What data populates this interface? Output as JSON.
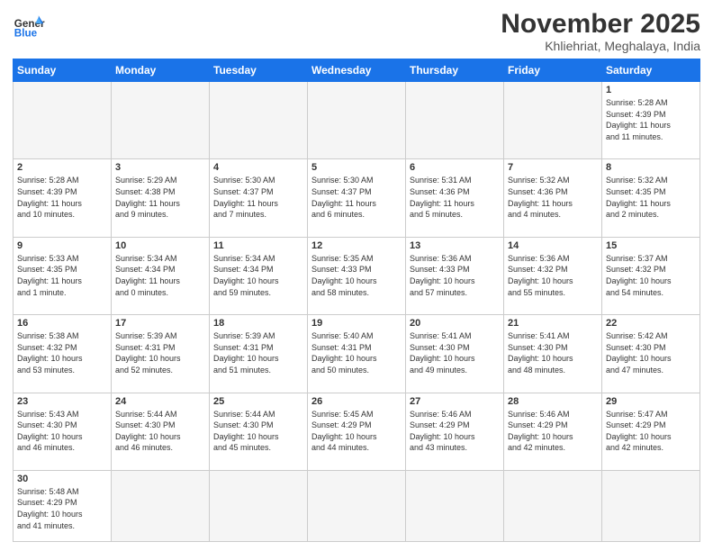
{
  "header": {
    "logo_text_regular": "General",
    "logo_text_blue": "Blue",
    "month_title": "November 2025",
    "subtitle": "Khliehriat, Meghalaya, India"
  },
  "weekdays": [
    "Sunday",
    "Monday",
    "Tuesday",
    "Wednesday",
    "Thursday",
    "Friday",
    "Saturday"
  ],
  "weeks": [
    [
      {
        "day": "",
        "info": ""
      },
      {
        "day": "",
        "info": ""
      },
      {
        "day": "",
        "info": ""
      },
      {
        "day": "",
        "info": ""
      },
      {
        "day": "",
        "info": ""
      },
      {
        "day": "",
        "info": ""
      },
      {
        "day": "1",
        "info": "Sunrise: 5:28 AM\nSunset: 4:39 PM\nDaylight: 11 hours\nand 11 minutes."
      }
    ],
    [
      {
        "day": "2",
        "info": "Sunrise: 5:28 AM\nSunset: 4:39 PM\nDaylight: 11 hours\nand 10 minutes."
      },
      {
        "day": "3",
        "info": "Sunrise: 5:29 AM\nSunset: 4:38 PM\nDaylight: 11 hours\nand 9 minutes."
      },
      {
        "day": "4",
        "info": "Sunrise: 5:30 AM\nSunset: 4:37 PM\nDaylight: 11 hours\nand 7 minutes."
      },
      {
        "day": "5",
        "info": "Sunrise: 5:30 AM\nSunset: 4:37 PM\nDaylight: 11 hours\nand 6 minutes."
      },
      {
        "day": "6",
        "info": "Sunrise: 5:31 AM\nSunset: 4:36 PM\nDaylight: 11 hours\nand 5 minutes."
      },
      {
        "day": "7",
        "info": "Sunrise: 5:32 AM\nSunset: 4:36 PM\nDaylight: 11 hours\nand 4 minutes."
      },
      {
        "day": "8",
        "info": "Sunrise: 5:32 AM\nSunset: 4:35 PM\nDaylight: 11 hours\nand 2 minutes."
      }
    ],
    [
      {
        "day": "9",
        "info": "Sunrise: 5:33 AM\nSunset: 4:35 PM\nDaylight: 11 hours\nand 1 minute."
      },
      {
        "day": "10",
        "info": "Sunrise: 5:34 AM\nSunset: 4:34 PM\nDaylight: 11 hours\nand 0 minutes."
      },
      {
        "day": "11",
        "info": "Sunrise: 5:34 AM\nSunset: 4:34 PM\nDaylight: 10 hours\nand 59 minutes."
      },
      {
        "day": "12",
        "info": "Sunrise: 5:35 AM\nSunset: 4:33 PM\nDaylight: 10 hours\nand 58 minutes."
      },
      {
        "day": "13",
        "info": "Sunrise: 5:36 AM\nSunset: 4:33 PM\nDaylight: 10 hours\nand 57 minutes."
      },
      {
        "day": "14",
        "info": "Sunrise: 5:36 AM\nSunset: 4:32 PM\nDaylight: 10 hours\nand 55 minutes."
      },
      {
        "day": "15",
        "info": "Sunrise: 5:37 AM\nSunset: 4:32 PM\nDaylight: 10 hours\nand 54 minutes."
      }
    ],
    [
      {
        "day": "16",
        "info": "Sunrise: 5:38 AM\nSunset: 4:32 PM\nDaylight: 10 hours\nand 53 minutes."
      },
      {
        "day": "17",
        "info": "Sunrise: 5:39 AM\nSunset: 4:31 PM\nDaylight: 10 hours\nand 52 minutes."
      },
      {
        "day": "18",
        "info": "Sunrise: 5:39 AM\nSunset: 4:31 PM\nDaylight: 10 hours\nand 51 minutes."
      },
      {
        "day": "19",
        "info": "Sunrise: 5:40 AM\nSunset: 4:31 PM\nDaylight: 10 hours\nand 50 minutes."
      },
      {
        "day": "20",
        "info": "Sunrise: 5:41 AM\nSunset: 4:30 PM\nDaylight: 10 hours\nand 49 minutes."
      },
      {
        "day": "21",
        "info": "Sunrise: 5:41 AM\nSunset: 4:30 PM\nDaylight: 10 hours\nand 48 minutes."
      },
      {
        "day": "22",
        "info": "Sunrise: 5:42 AM\nSunset: 4:30 PM\nDaylight: 10 hours\nand 47 minutes."
      }
    ],
    [
      {
        "day": "23",
        "info": "Sunrise: 5:43 AM\nSunset: 4:30 PM\nDaylight: 10 hours\nand 46 minutes."
      },
      {
        "day": "24",
        "info": "Sunrise: 5:44 AM\nSunset: 4:30 PM\nDaylight: 10 hours\nand 46 minutes."
      },
      {
        "day": "25",
        "info": "Sunrise: 5:44 AM\nSunset: 4:30 PM\nDaylight: 10 hours\nand 45 minutes."
      },
      {
        "day": "26",
        "info": "Sunrise: 5:45 AM\nSunset: 4:29 PM\nDaylight: 10 hours\nand 44 minutes."
      },
      {
        "day": "27",
        "info": "Sunrise: 5:46 AM\nSunset: 4:29 PM\nDaylight: 10 hours\nand 43 minutes."
      },
      {
        "day": "28",
        "info": "Sunrise: 5:46 AM\nSunset: 4:29 PM\nDaylight: 10 hours\nand 42 minutes."
      },
      {
        "day": "29",
        "info": "Sunrise: 5:47 AM\nSunset: 4:29 PM\nDaylight: 10 hours\nand 42 minutes."
      }
    ],
    [
      {
        "day": "30",
        "info": "Sunrise: 5:48 AM\nSunset: 4:29 PM\nDaylight: 10 hours\nand 41 minutes."
      },
      {
        "day": "",
        "info": ""
      },
      {
        "day": "",
        "info": ""
      },
      {
        "day": "",
        "info": ""
      },
      {
        "day": "",
        "info": ""
      },
      {
        "day": "",
        "info": ""
      },
      {
        "day": "",
        "info": ""
      }
    ]
  ]
}
